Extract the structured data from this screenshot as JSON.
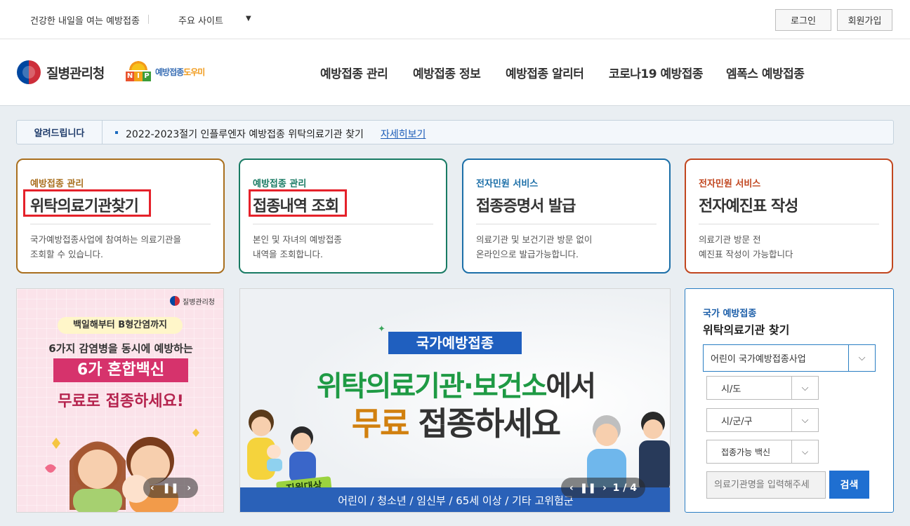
{
  "topbar": {
    "slogan": "건강한 내일을 여는 예방접종",
    "sites": "주요 사이트",
    "login": "로그인",
    "signup": "회원가입"
  },
  "logo": {
    "kdca": "질병관리청",
    "nip_prefix": "예방접종",
    "nip_suffix": "도우미",
    "nip_letters": [
      "N",
      "I",
      "P"
    ]
  },
  "nav": [
    "예방접종 관리",
    "예방접종 정보",
    "예방접종 알리터",
    "코로나19 예방접종",
    "엠폭스 예방접종"
  ],
  "notice": {
    "tag": "알려드립니다",
    "message": "2022-2023절기 인플루엔자 예방접종 위탁의료기관 찾기",
    "more": "자세히보기"
  },
  "cards": [
    {
      "category": "예방접종 관리",
      "title": "위탁의료기관찾기",
      "desc1": "국가예방접종사업에 참여하는 의료기관을",
      "desc2": "조회할 수 있습니다.",
      "color": "#a96f1e"
    },
    {
      "category": "예방접종 관리",
      "title": "접종내역 조회",
      "desc1": "본인 및 자녀의 예방접종",
      "desc2": "내역을 조회합니다.",
      "color": "#187a63"
    },
    {
      "category": "전자민원 서비스",
      "title": "접종증명서 발급",
      "desc1": "의료기관 및 보건기관 방문 없이",
      "desc2": "온라인으로 발급가능합니다.",
      "color": "#1c6fa8"
    },
    {
      "category": "전자민원 서비스",
      "title": "전자예진표 작성",
      "desc1": "의료기관 방문 전",
      "desc2": "예진표 작성이 가능합니다",
      "color": "#c1461f"
    }
  ],
  "banner_left": {
    "org": "질병관리청",
    "line1": "백일해부터 B형간염까지",
    "line2": "6가지 감염병을 동시에 예방하는",
    "line3": "6가 혼합백신",
    "line4": "무료로 접종하세요!"
  },
  "banner_mid": {
    "badge": "국가예방접종",
    "line1a": "위탁의료기관·보건소",
    "line1b": "에서",
    "line2a": "무료",
    "line2b": " 접종하세요",
    "target": "지원대상",
    "footer": "어린이 / 청소년 / 임신부 / 65세 이상 / 기타 고위험군",
    "page": "1 / 4"
  },
  "search": {
    "label1": "국가 예방접종",
    "label2": "위탁의료기관 찾기",
    "program": "어린이 국가예방접종사업",
    "sido": "시/도",
    "sigungu": "시/군/구",
    "vaccine": "접종가능 백신",
    "placeholder": "의료기관명을 입력해주세",
    "button": "검색"
  }
}
